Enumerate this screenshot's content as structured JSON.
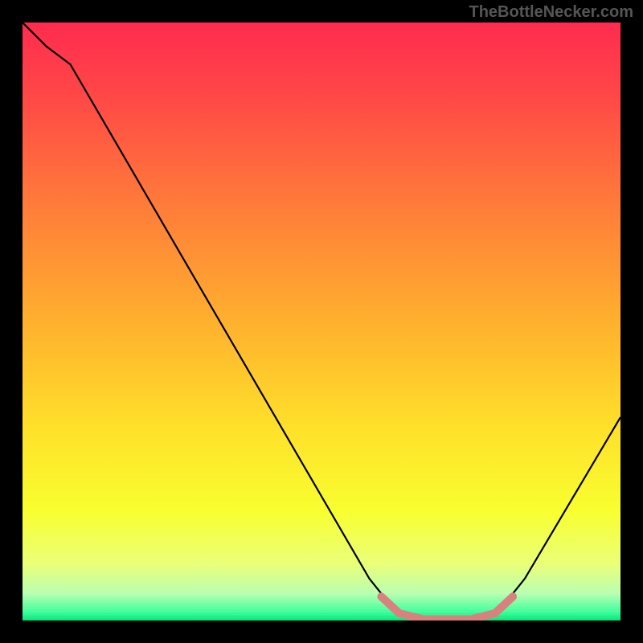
{
  "watermark": "TheBottleNecker.com",
  "chart_data": {
    "type": "line",
    "title": "",
    "xlabel": "",
    "ylabel": "",
    "x_range": [
      0,
      100
    ],
    "y_range": [
      0,
      100
    ],
    "curve": [
      {
        "x": 0,
        "y": 100
      },
      {
        "x": 4,
        "y": 96
      },
      {
        "x": 8,
        "y": 93
      },
      {
        "x": 58,
        "y": 7
      },
      {
        "x": 62,
        "y": 2
      },
      {
        "x": 66,
        "y": 0
      },
      {
        "x": 76,
        "y": 0
      },
      {
        "x": 80,
        "y": 2
      },
      {
        "x": 84,
        "y": 7
      },
      {
        "x": 100,
        "y": 34
      }
    ],
    "highlight_segment": {
      "color": "#d9817e",
      "points": [
        {
          "x": 60,
          "y": 4
        },
        {
          "x": 63,
          "y": 1.2
        },
        {
          "x": 67,
          "y": 0.2
        },
        {
          "x": 75,
          "y": 0.2
        },
        {
          "x": 79,
          "y": 1.2
        },
        {
          "x": 82,
          "y": 4
        }
      ]
    },
    "gradient_stops": [
      {
        "offset": 0.0,
        "color": "#ff2b4f"
      },
      {
        "offset": 0.12,
        "color": "#ff4747"
      },
      {
        "offset": 0.3,
        "color": "#ff7a3a"
      },
      {
        "offset": 0.5,
        "color": "#ffb02e"
      },
      {
        "offset": 0.68,
        "color": "#ffe12a"
      },
      {
        "offset": 0.82,
        "color": "#f8ff2f"
      },
      {
        "offset": 0.905,
        "color": "#eaff76"
      },
      {
        "offset": 0.955,
        "color": "#b7ffb0"
      },
      {
        "offset": 0.985,
        "color": "#3fff9a"
      },
      {
        "offset": 1.0,
        "color": "#00e57a"
      }
    ],
    "stripe_band": {
      "y0": 0.82,
      "y1": 1.0
    }
  }
}
